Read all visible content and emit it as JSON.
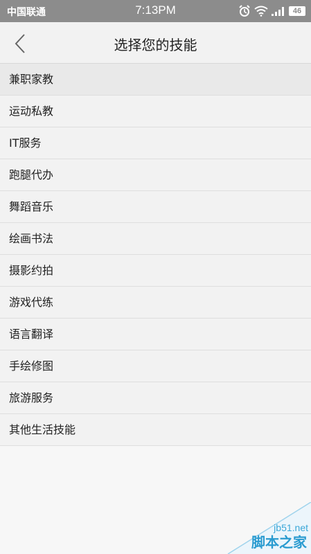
{
  "status_bar": {
    "carrier": "中国联通",
    "time": "7:13PM",
    "battery": "46",
    "icons": [
      "alarm-icon",
      "wifi-icon",
      "signal-icon",
      "battery-icon"
    ]
  },
  "header": {
    "title": "选择您的技能",
    "back_icon": "chevron-left-icon"
  },
  "skills": [
    "兼职家教",
    "运动私教",
    "IT服务",
    "跑腿代办",
    "舞蹈音乐",
    "绘画书法",
    "摄影约拍",
    "游戏代练",
    "语言翻译",
    "手绘修图",
    "旅游服务",
    "其他生活技能"
  ],
  "watermark": {
    "url": "jb51.net",
    "name": "脚本之家"
  },
  "colors": {
    "status_bar": "#8c8c8c",
    "header_bg": "#f2f2f2",
    "watermark": "#2a9bd0"
  }
}
